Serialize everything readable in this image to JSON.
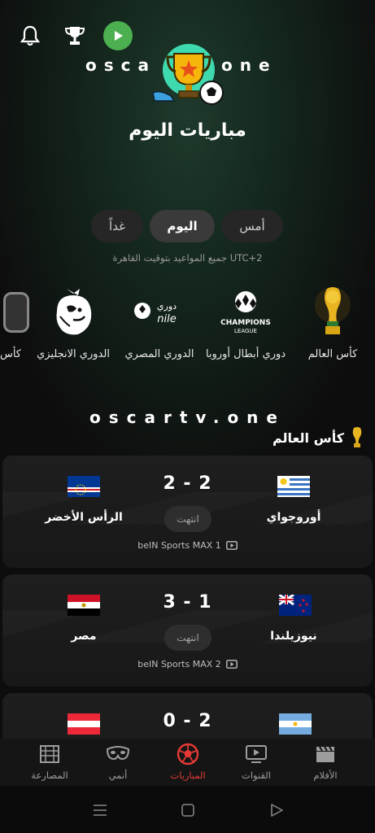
{
  "header": {
    "brand_left": "osca",
    "brand_right": "one",
    "title": "مباريات اليوم",
    "icons": [
      "bell-icon",
      "trophy-icon",
      "play-icon"
    ]
  },
  "day_tabs": [
    {
      "label": "أمس",
      "active": false
    },
    {
      "label": "اليوم",
      "active": true
    },
    {
      "label": "غداً",
      "active": false
    }
  ],
  "timezone_note": "جميع المواعيد بتوقيت القاهرة UTC+2",
  "leagues": [
    {
      "name": "كأس العالم",
      "icon": "world-cup-trophy-icon"
    },
    {
      "name": "دوري أبطال أوروبا",
      "icon": "champions-league-logo",
      "logo_text_1": "CHAMPIONS",
      "logo_text_2": "LEAGUE"
    },
    {
      "name": "الدوري المصري",
      "icon": "nile-league-logo",
      "logo_text_1": "دوري",
      "logo_text_2": "nile"
    },
    {
      "name": "الدوري الانجليزي",
      "icon": "premier-league-lion-logo"
    },
    {
      "name": "كأس",
      "icon": "cup-logo-partial"
    }
  ],
  "section": {
    "brand": "oscartv.one",
    "title": "كأس العالم",
    "icon": "trophy-icon"
  },
  "matches": [
    {
      "home": "أوروجواي",
      "home_flag": "uruguay-flag",
      "away": "الرأس الأخضر",
      "away_flag": "cape-verde-flag",
      "score": "2 - 2",
      "status": "انتهت",
      "channel": "beIN Sports MAX 1"
    },
    {
      "home": "نيوزيلندا",
      "home_flag": "new-zealand-flag",
      "away": "مصر",
      "away_flag": "egypt-flag",
      "score": "3 - 1",
      "status": "انتهت",
      "channel": "beIN Sports MAX 2"
    },
    {
      "home": "",
      "home_flag": "argentina-flag",
      "away": "",
      "away_flag": "austria-flag",
      "score": "0 - 2",
      "status": "",
      "channel": ""
    }
  ],
  "bottom_nav": [
    {
      "label": "المصارعة",
      "icon": "wrestling-icon",
      "active": false
    },
    {
      "label": "أنمي",
      "icon": "anime-mask-icon",
      "active": false
    },
    {
      "label": "المباريات",
      "icon": "football-icon",
      "active": true
    },
    {
      "label": "القنوات",
      "icon": "tv-play-icon",
      "active": false
    },
    {
      "label": "الأفلام",
      "icon": "clapperboard-icon",
      "active": false
    }
  ],
  "colors": {
    "accent": "#e53935",
    "play_button": "#4caf50",
    "card": "#1b1b1b"
  }
}
